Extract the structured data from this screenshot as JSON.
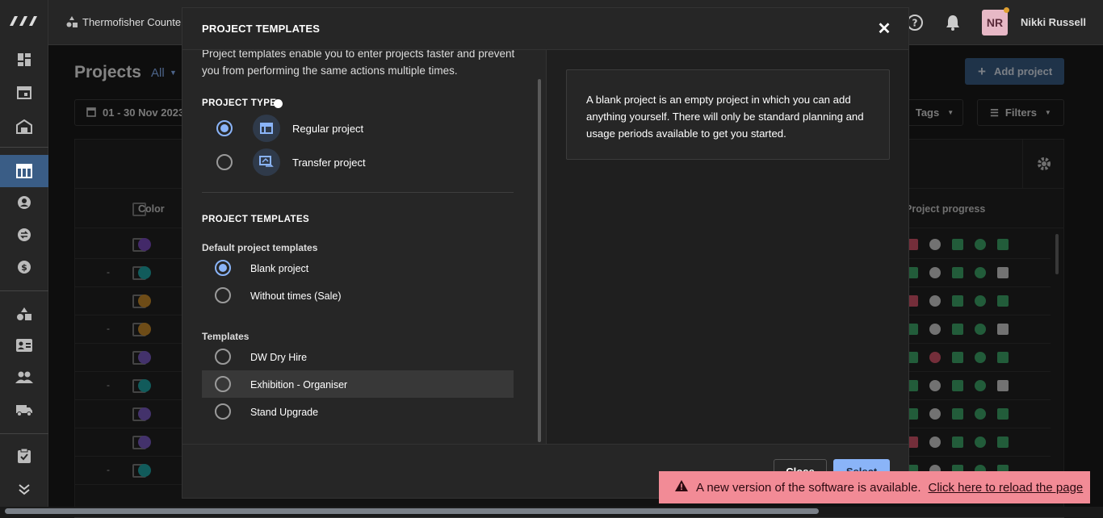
{
  "topbar": {
    "org_name": "Thermofisher Counte",
    "user_initials": "NR",
    "user_name": "Nikki Russell"
  },
  "projects_page": {
    "title": "Projects",
    "filter_all": "All",
    "add_project": "Add project",
    "date_range": "01 - 30 Nov 2023",
    "tags": "Tags",
    "filters": "Filters",
    "col_color": "Color",
    "col_progress": "Project progress",
    "rows": [
      {
        "dash": "",
        "color": "#7b4bbf"
      },
      {
        "dash": "-",
        "color": "#1fa6a6"
      },
      {
        "dash": "",
        "color": "#c98a2a"
      },
      {
        "dash": "-",
        "color": "#c98a2a"
      },
      {
        "dash": "",
        "color": "#7b5cc4"
      },
      {
        "dash": "-",
        "color": "#1fa6a6"
      },
      {
        "dash": "",
        "color": "#7b5cc4"
      },
      {
        "dash": "",
        "color": "#7b5cc4"
      },
      {
        "dash": "-",
        "color": "#1fa6a6"
      }
    ]
  },
  "modal": {
    "title": "PROJECT TEMPLATES",
    "intro_line1": "Project templates enable you to enter projects faster and prevent",
    "intro_line2": "you from performing the same actions multiple times.",
    "project_type_heading": "PROJECT TYPE",
    "types": [
      {
        "label": "Regular project",
        "selected": true
      },
      {
        "label": "Transfer project",
        "selected": false
      }
    ],
    "templates_heading": "PROJECT TEMPLATES",
    "default_heading": "Default project templates",
    "default_templates": [
      {
        "label": "Blank project",
        "selected": true
      },
      {
        "label": "Without times (Sale)",
        "selected": false
      }
    ],
    "templates_sub": "Templates",
    "templates": [
      {
        "label": "DW Dry Hire"
      },
      {
        "label": "Exhibition - Organiser"
      },
      {
        "label": "Stand Upgrade"
      }
    ],
    "description": "A blank project is an empty project in which you can add anything yourself. There will only be standard planning and usage periods available to get you started.",
    "close_button": "Close",
    "select_button": "Select"
  },
  "toast": {
    "message": "A new version of the software is available.",
    "link": "Click here to reload the page"
  },
  "colors": {
    "accent": "#8ab4f8",
    "toast_bg": "#f28b96",
    "progress_green": "#3ea86b",
    "progress_red": "#d4546a"
  }
}
